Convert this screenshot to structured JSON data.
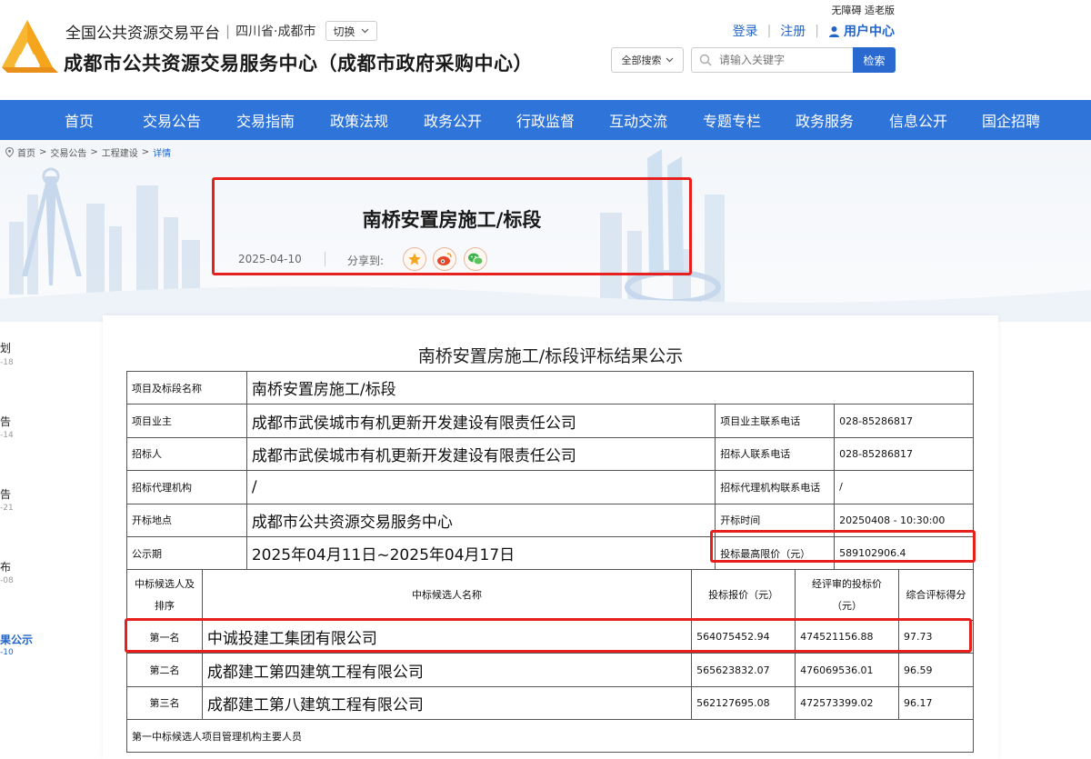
{
  "header": {
    "platform": "全国公共资源交易平台",
    "region": "四川省·成都市",
    "switch_label": "切换",
    "site_name": "成都市公共资源交易服务中心（成都市政府采购中心）",
    "accessibility": "无障碍 适老版",
    "login": "登录",
    "register": "注册",
    "user_center": "用户中心",
    "search_scope": "全部搜索",
    "search_placeholder": "请输入关键字",
    "search_button": "检索"
  },
  "nav": [
    "首页",
    "交易公告",
    "交易指南",
    "政策法规",
    "政务公开",
    "行政监督",
    "互动交流",
    "专题专栏",
    "政务服务",
    "信息公开",
    "国企招聘"
  ],
  "breadcrumb": {
    "home": "首页",
    "sep": ">",
    "l1": "交易公告",
    "l2": "工程建设",
    "current": "详情"
  },
  "article": {
    "title": "南桥安置房施工/标段",
    "date": "2025-04-10",
    "share_label": "分享到:"
  },
  "side_list": [
    {
      "label": "划",
      "date": "-18"
    },
    {
      "label": "告",
      "date": "-14"
    },
    {
      "label": "告",
      "date": "-21"
    },
    {
      "label": "布",
      "date": "-08"
    },
    {
      "label": "果公示",
      "date": "-10"
    }
  ],
  "doc": {
    "title": "南桥安置房施工/标段评标结果公示",
    "rows": {
      "project_name_label": "项目及标段名称",
      "project_name": "南桥安置房施工/标段",
      "owner_label": "项目业主",
      "owner": "成都市武侯城市有机更新开发建设有限责任公司",
      "owner_phone_label": "项目业主联系电话",
      "owner_phone": "028-85286817",
      "tenderer_label": "招标人",
      "tenderer": "成都市武侯城市有机更新开发建设有限责任公司",
      "tenderer_phone_label": "招标人联系电话",
      "tenderer_phone": "028-85286817",
      "agency_label": "招标代理机构",
      "agency": "/",
      "agency_phone_label": "招标代理机构联系电话",
      "agency_phone": "/",
      "venue_label": "开标地点",
      "venue": "成都市公共资源交易服务中心",
      "open_time_label": "开标时间",
      "open_time": "20250408 - 10:30:00",
      "period_label": "公示期",
      "period": "2025年04月11日~2025年04月17日",
      "max_price_label": "投标最高限价（元）",
      "max_price": "589102906.4"
    },
    "candidates_header": {
      "rank_line1": "中标候选人及",
      "rank_line2": "排序",
      "name": "中标候选人名称",
      "bid": "投标报价（元）",
      "reviewed_line1": "经评审的投标价",
      "reviewed_line2": "（元）",
      "score": "综合评标得分"
    },
    "candidates": [
      {
        "rank": "第一名",
        "name": "中诚投建工集团有限公司",
        "bid": "564075452.94",
        "reviewed": "474521156.88",
        "score": "97.73"
      },
      {
        "rank": "第二名",
        "name": "成都建工第四建筑工程有限公司",
        "bid": "565623832.07",
        "reviewed": "476069536.01",
        "score": "96.59"
      },
      {
        "rank": "第三名",
        "name": "成都建工第八建筑工程有限公司",
        "bid": "562127695.08",
        "reviewed": "472573399.02",
        "score": "96.17"
      }
    ],
    "staff_label": "第一中标候选人项目管理机构主要人员"
  },
  "colors": {
    "nav_bg": "#2f74d9",
    "accent": "#2265c7",
    "highlight": "#e8201d"
  }
}
